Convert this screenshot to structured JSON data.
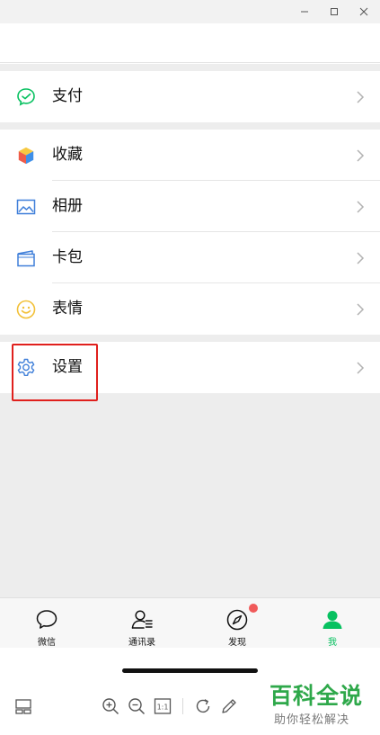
{
  "menu": {
    "group1": [
      {
        "label": "支付",
        "icon": "wechat-pay-icon"
      }
    ],
    "group2": [
      {
        "label": "收藏",
        "icon": "favorites-cube-icon"
      },
      {
        "label": "相册",
        "icon": "album-image-icon"
      },
      {
        "label": "卡包",
        "icon": "card-wallet-icon"
      },
      {
        "label": "表情",
        "icon": "smiley-icon"
      }
    ],
    "group3": [
      {
        "label": "设置",
        "icon": "gear-icon"
      }
    ]
  },
  "tabs": [
    {
      "label": "微信",
      "icon": "chat-bubble-icon",
      "active": false
    },
    {
      "label": "通讯录",
      "icon": "contacts-icon",
      "active": false
    },
    {
      "label": "发现",
      "icon": "compass-icon",
      "active": false,
      "badge_dot": true
    },
    {
      "label": "我",
      "icon": "person-icon",
      "active": true
    }
  ],
  "viewer_toolbar": {
    "actual_size_label": "1:1",
    "icons": [
      "layout-icon",
      "zoom-in-icon",
      "zoom-out-icon",
      "actual-size-icon",
      "rotate-icon",
      "edit-pencil-icon"
    ]
  },
  "watermark": {
    "title": "百科全说",
    "subtitle": "助你轻松解决"
  },
  "colors": {
    "accent_green": "#07c160",
    "highlight_red": "#e0201d",
    "badge_red": "#f05a5a"
  }
}
